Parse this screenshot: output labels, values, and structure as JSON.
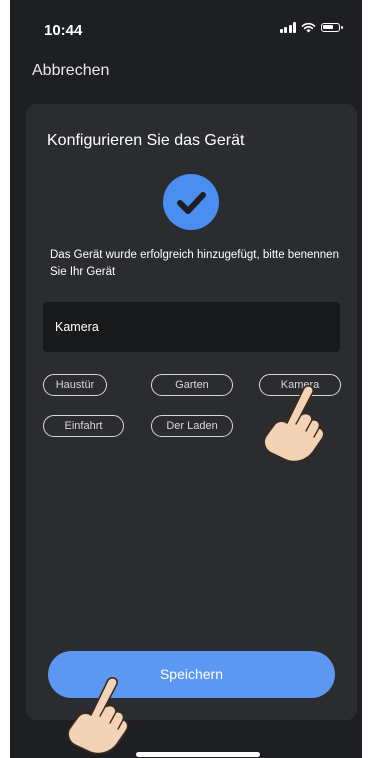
{
  "status_bar": {
    "time": "10:44"
  },
  "nav": {
    "cancel_label": "Abbrechen"
  },
  "card": {
    "title": "Konfigurieren Sie das Gerät",
    "description": "Das Gerät wurde erfolgreich hinzugefügt, bitte benennen Sie Ihr Gerät",
    "name_input": {
      "value": "Kamera"
    },
    "chips": [
      "Haustür",
      "Garten",
      "Kamera",
      "Einfahrt",
      "Der Laden"
    ],
    "save_label": "Speichern"
  },
  "colors": {
    "accent": "#4a8ff0",
    "button": "#5c97f1",
    "background": "#1e1f22",
    "card": "#2b2c30"
  },
  "icons": [
    "signal-icon",
    "wifi-icon",
    "battery-icon",
    "checkmark-icon",
    "tap-hand-icon"
  ]
}
